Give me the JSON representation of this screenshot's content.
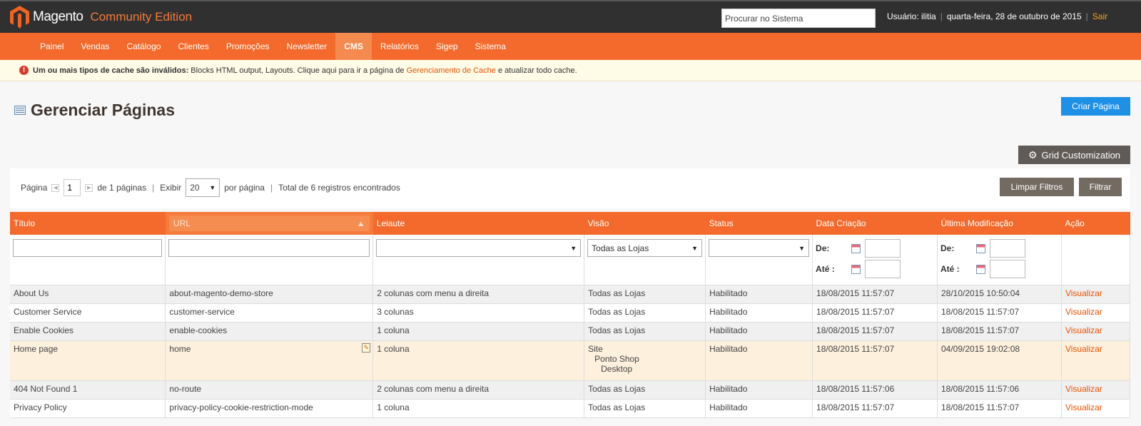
{
  "header": {
    "logo_text": "Magento",
    "edition": "Community Edition",
    "search_placeholder": "Procurar no Sistema",
    "user_label": "Usuário: ilitia",
    "separator": "|",
    "date": "quarta-feira, 28 de outubro de 2015",
    "logout": "Sair"
  },
  "nav": [
    "Painel",
    "Vendas",
    "Catálogo",
    "Clientes",
    "Promoções",
    "Newsletter",
    "CMS",
    "Relatórios",
    "Sigep",
    "Sistema"
  ],
  "message": {
    "bold": "Um ou mais tipos de cache são inválidos:",
    "text": " Blocks HTML output, Layouts. Clique aqui para ir a página de ",
    "link": "Gerenciamento de Cache",
    "tail": " e atualizar todo cache."
  },
  "page": {
    "title": "Gerenciar Páginas",
    "add_button": "Criar Página",
    "grid_customization": "Grid Customization"
  },
  "pager": {
    "page_label": "Página",
    "page_value": "1",
    "of_pages": "de 1 páginas",
    "sep": "|",
    "show_label": "Exibir",
    "per_page_value": "20",
    "per_page_label": "por página",
    "total": "Total de 6 registros encontrados",
    "reset_filter": "Limpar Filtros",
    "search": "Filtrar"
  },
  "columns": {
    "title": "Título",
    "url": "URL",
    "layout": "Leiaute",
    "view": "Visão",
    "status": "Status",
    "created": "Data Criação",
    "modified": "Última Modificação",
    "action": "Ação"
  },
  "filters": {
    "view_selected": "Todas as Lojas",
    "from": "De:",
    "to": "Até :"
  },
  "rows": [
    {
      "title": "About Us",
      "url": "about-magento-demo-store",
      "layout": "2 colunas com menu a direita",
      "view": "Todas as Lojas",
      "status": "Habilitado",
      "created": "18/08/2015 11:57:07",
      "modified": "28/10/2015 10:50:04",
      "action": "Visualizar"
    },
    {
      "title": "Customer Service",
      "url": "customer-service",
      "layout": "3 colunas",
      "view": "Todas as Lojas",
      "status": "Habilitado",
      "created": "18/08/2015 11:57:07",
      "modified": "18/08/2015 11:57:07",
      "action": "Visualizar"
    },
    {
      "title": "Enable Cookies",
      "url": "enable-cookies",
      "layout": "1 coluna",
      "view": "Todas as Lojas",
      "status": "Habilitado",
      "created": "18/08/2015 11:57:07",
      "modified": "18/08/2015 11:57:07",
      "action": "Visualizar"
    },
    {
      "title": "Home page",
      "url": "home",
      "layout": "1 coluna",
      "view_lines": [
        "Site",
        "Ponto Shop",
        "Desktop"
      ],
      "status": "Habilitado",
      "created": "18/08/2015 11:57:07",
      "modified": "04/09/2015 19:02:08",
      "action": "Visualizar"
    },
    {
      "title": "404 Not Found 1",
      "url": "no-route",
      "layout": "2 colunas com menu a direita",
      "view": "Todas as Lojas",
      "status": "Habilitado",
      "created": "18/08/2015 11:57:06",
      "modified": "18/08/2015 11:57:06",
      "action": "Visualizar"
    },
    {
      "title": "Privacy Policy",
      "url": "privacy-policy-cookie-restriction-mode",
      "layout": "1 coluna",
      "view": "Todas as Lojas",
      "status": "Habilitado",
      "created": "18/08/2015 11:57:07",
      "modified": "18/08/2015 11:57:07",
      "action": "Visualizar"
    }
  ],
  "colors": {
    "header_bg": "#303030",
    "nav_bg": "#f36a2c",
    "accent": "#eb5202",
    "primary_button": "#1e90e6"
  }
}
